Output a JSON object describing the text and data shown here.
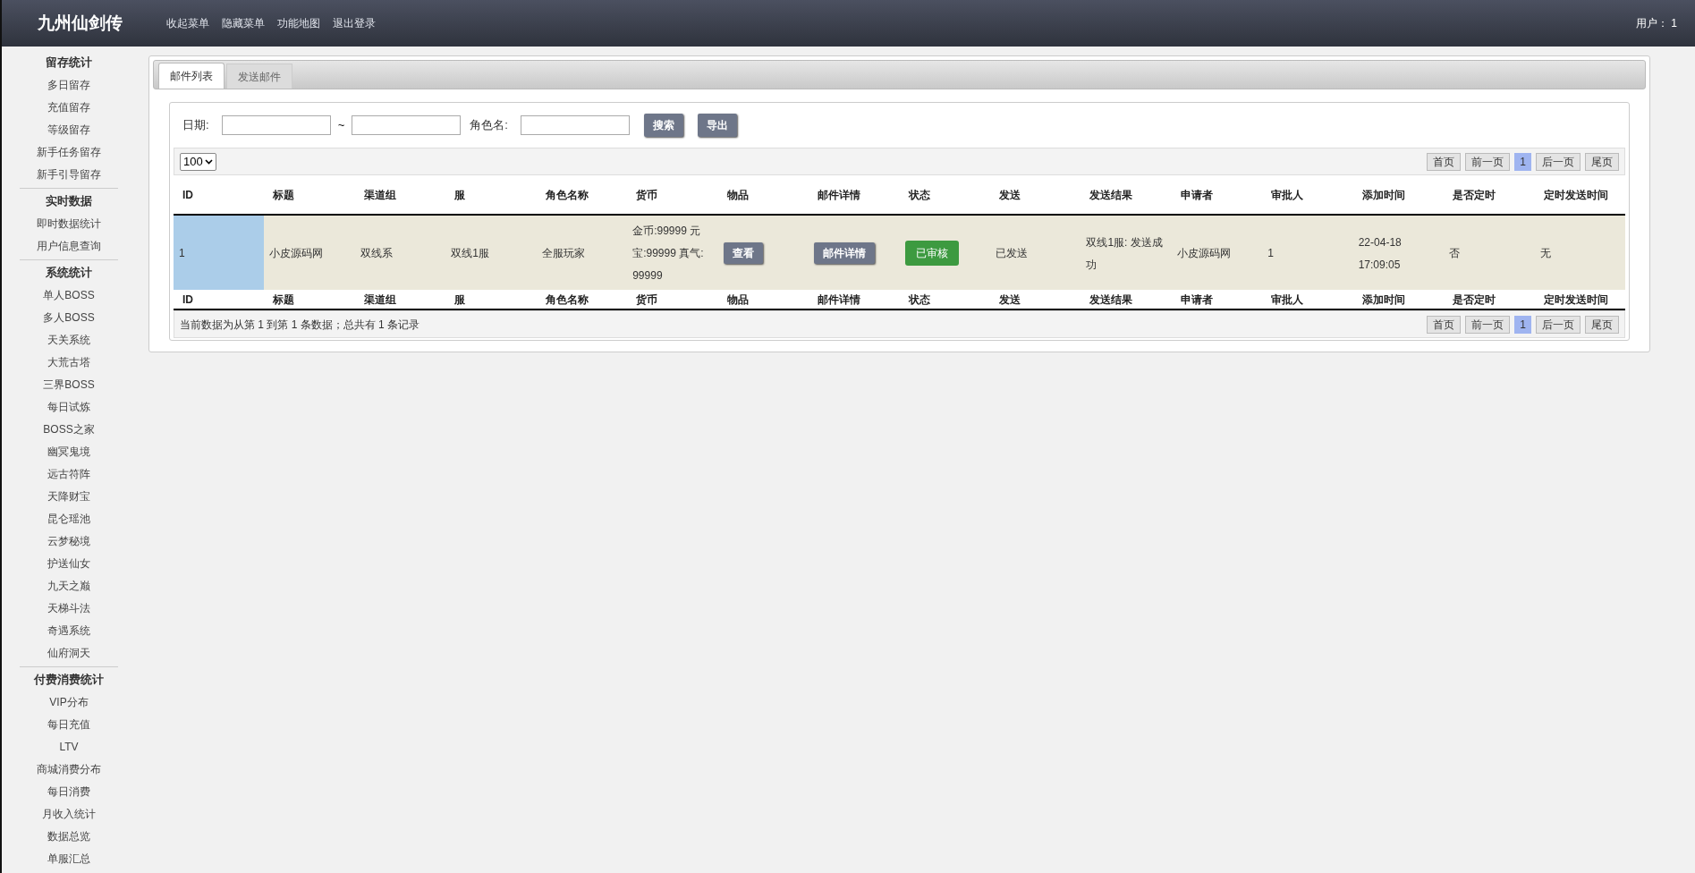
{
  "app_title": "九州仙剑传",
  "top_menu": [
    "收起菜单",
    "隐藏菜单",
    "功能地图",
    "退出登录"
  ],
  "user": "用户： 1",
  "sidebar": [
    {
      "title": "留存统计",
      "items": [
        "多日留存",
        "充值留存",
        "等级留存",
        "新手任务留存",
        "新手引导留存"
      ]
    },
    {
      "title": "实时数据",
      "items": [
        "即时数据统计",
        "用户信息查询"
      ]
    },
    {
      "title": "系统统计",
      "items": [
        "单人BOSS",
        "多人BOSS",
        "天关系统",
        "大荒古塔",
        "三界BOSS",
        "每日试炼",
        "BOSS之家",
        "幽冥鬼境",
        "远古符阵",
        "天降财宝",
        "昆仑瑶池",
        "云梦秘境",
        "护送仙女",
        "九天之巅",
        "天梯斗法",
        "奇遇系统",
        "仙府洞天"
      ]
    },
    {
      "title": "付费消费统计",
      "items": [
        "VIP分布",
        "每日充值",
        "LTV",
        "商城消费分布",
        "每日消费",
        "月收入统计",
        "数据总览",
        "单服汇总"
      ]
    }
  ],
  "tabs": [
    {
      "label": "邮件列表",
      "selected": true
    },
    {
      "label": "发送邮件",
      "selected": false
    }
  ],
  "filter": {
    "date_label": "日期:",
    "range_sep": "~",
    "role_label": "角色名:",
    "buttons": [
      "搜索",
      "导出"
    ]
  },
  "page_size": "100",
  "pagination": [
    {
      "label": "首页",
      "selected": false
    },
    {
      "label": "前一页",
      "selected": false
    },
    {
      "label": "1",
      "selected": true
    },
    {
      "label": "后一页",
      "selected": false
    },
    {
      "label": "尾页",
      "selected": false
    }
  ],
  "table": {
    "columns": [
      "ID",
      "标题",
      "渠道组",
      "服",
      "角色名称",
      "货币",
      "物品",
      "邮件详情",
      "状态",
      "发送",
      "发送结果",
      "申请者",
      "审批人",
      "添加时间",
      "是否定时",
      "定时发送时间"
    ],
    "rows": [
      {
        "cells": [
          {
            "kind": "text",
            "text": "1",
            "sorted": true
          },
          {
            "kind": "text",
            "text": "小皮源码网",
            "sorted": false
          },
          {
            "kind": "text",
            "text": "双线系",
            "sorted": false
          },
          {
            "kind": "text",
            "text": "双线1服",
            "sorted": false
          },
          {
            "kind": "text",
            "text": "全服玩家",
            "sorted": false
          },
          {
            "kind": "text",
            "text": "金币:99999 元宝:99999 真气: 99999",
            "sorted": false
          },
          {
            "kind": "button",
            "text": "查看",
            "sorted": false
          },
          {
            "kind": "button",
            "text": "邮件详情",
            "sorted": false
          },
          {
            "kind": "status",
            "text": "已审核",
            "sorted": false
          },
          {
            "kind": "text",
            "text": "已发送",
            "sorted": false
          },
          {
            "kind": "text",
            "text": "双线1服: 发送成功",
            "sorted": false
          },
          {
            "kind": "text",
            "text": "小皮源码网",
            "sorted": false
          },
          {
            "kind": "text",
            "text": "1",
            "sorted": false
          },
          {
            "kind": "text",
            "text": "22-04-18 17:09:05",
            "sorted": false
          },
          {
            "kind": "text",
            "text": "否",
            "sorted": false
          },
          {
            "kind": "text",
            "text": "无",
            "sorted": false
          }
        ]
      }
    ]
  },
  "footer_columns": [
    "ID",
    "标题",
    "渠道组",
    "服",
    "角色名称",
    "货币",
    "物品",
    "邮件详情",
    "状态",
    "发送",
    "发送结果",
    "申请者",
    "审批人",
    "添加时间",
    "是否定时",
    "定时发送时间"
  ],
  "pagination_bottom": [
    {
      "label": "首页",
      "selected": false
    },
    {
      "label": "前一页",
      "selected": false
    },
    {
      "label": "1",
      "selected": true
    },
    {
      "label": "后一页",
      "selected": false
    },
    {
      "label": "尾页",
      "selected": false
    }
  ],
  "info": "当前数据为从第 1 到第 1 条数据；总共有 1 条记录"
}
